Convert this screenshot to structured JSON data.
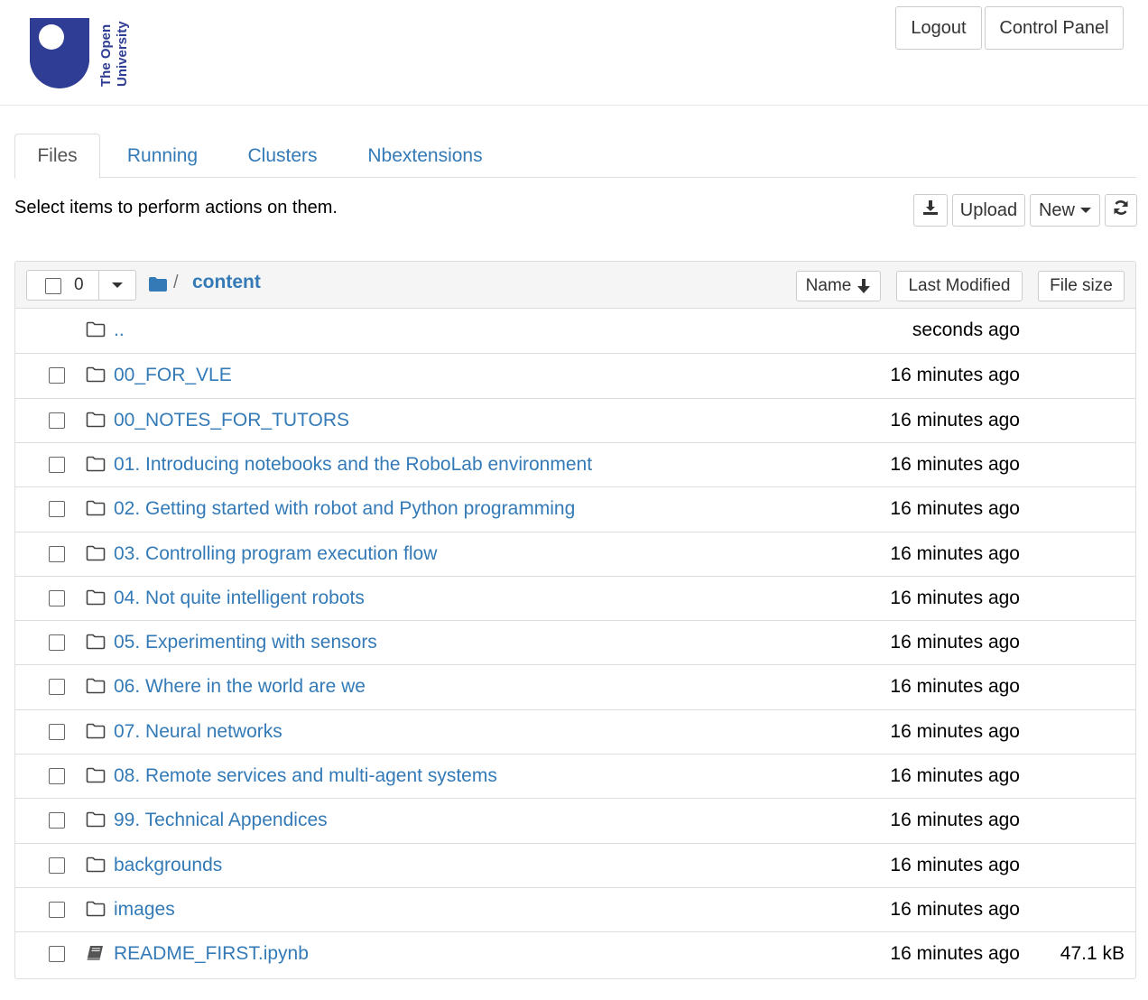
{
  "header": {
    "logo_text_line1": "The Open",
    "logo_text_line2": "University",
    "logout_label": "Logout",
    "control_panel_label": "Control Panel",
    "brand_color": "#2f3d94"
  },
  "tabs": [
    {
      "label": "Files",
      "active": true
    },
    {
      "label": "Running",
      "active": false
    },
    {
      "label": "Clusters",
      "active": false
    },
    {
      "label": "Nbextensions",
      "active": false
    }
  ],
  "toolbar": {
    "hint": "Select items to perform actions on them.",
    "download_icon": "download-icon",
    "upload_label": "Upload",
    "new_label": "New",
    "refresh_icon": "refresh-icon"
  },
  "list_header": {
    "selected_count": "0",
    "breadcrumb_separator": "/",
    "breadcrumb_folder": "content",
    "sort_name_label": "Name",
    "sort_modified_label": "Last Modified",
    "sort_size_label": "File size"
  },
  "rows": [
    {
      "name": "..",
      "modified": "seconds ago",
      "size": "",
      "type": "parent"
    },
    {
      "name": "00_FOR_VLE",
      "modified": "16 minutes ago",
      "size": "",
      "type": "folder"
    },
    {
      "name": "00_NOTES_FOR_TUTORS",
      "modified": "16 minutes ago",
      "size": "",
      "type": "folder"
    },
    {
      "name": "01. Introducing notebooks and the RoboLab environment",
      "modified": "16 minutes ago",
      "size": "",
      "type": "folder"
    },
    {
      "name": "02. Getting started with robot and Python programming",
      "modified": "16 minutes ago",
      "size": "",
      "type": "folder"
    },
    {
      "name": "03. Controlling program execution flow",
      "modified": "16 minutes ago",
      "size": "",
      "type": "folder"
    },
    {
      "name": "04. Not quite intelligent robots",
      "modified": "16 minutes ago",
      "size": "",
      "type": "folder"
    },
    {
      "name": "05. Experimenting with sensors",
      "modified": "16 minutes ago",
      "size": "",
      "type": "folder"
    },
    {
      "name": "06. Where in the world are we",
      "modified": "16 minutes ago",
      "size": "",
      "type": "folder"
    },
    {
      "name": "07. Neural networks",
      "modified": "16 minutes ago",
      "size": "",
      "type": "folder"
    },
    {
      "name": "08. Remote services and multi-agent systems",
      "modified": "16 minutes ago",
      "size": "",
      "type": "folder"
    },
    {
      "name": "99. Technical Appendices",
      "modified": "16 minutes ago",
      "size": "",
      "type": "folder"
    },
    {
      "name": "backgrounds",
      "modified": "16 minutes ago",
      "size": "",
      "type": "folder"
    },
    {
      "name": "images",
      "modified": "16 minutes ago",
      "size": "",
      "type": "folder"
    },
    {
      "name": "README_FIRST.ipynb",
      "modified": "16 minutes ago",
      "size": "47.1 kB",
      "type": "notebook"
    }
  ]
}
